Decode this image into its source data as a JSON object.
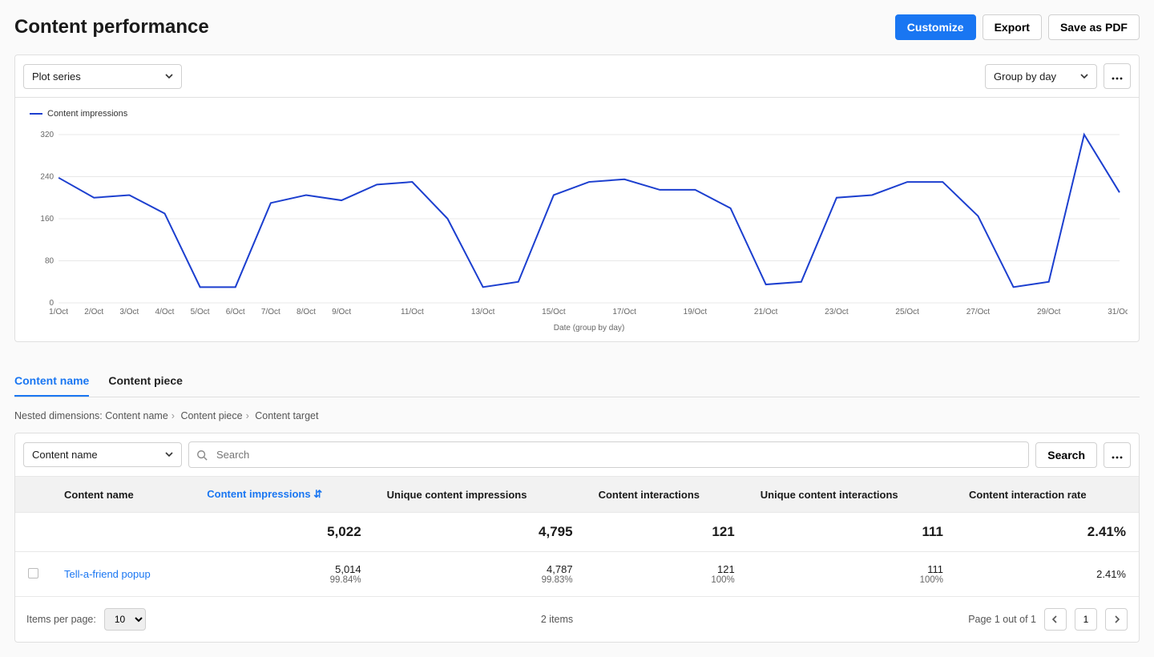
{
  "header": {
    "title": "Content performance",
    "customize": "Customize",
    "export": "Export",
    "savePdf": "Save as PDF"
  },
  "chartToolbar": {
    "plotSeries": "Plot series",
    "groupBy": "Group by day"
  },
  "chart_data": {
    "type": "line",
    "title": "",
    "xlabel": "Date (group by day)",
    "ylabel": "",
    "ylim": [
      0,
      320
    ],
    "legend": "Content impressions",
    "categories": [
      "1/Oct",
      "2/Oct",
      "3/Oct",
      "4/Oct",
      "5/Oct",
      "6/Oct",
      "7/Oct",
      "8/Oct",
      "9/Oct",
      "10/Oct",
      "11/Oct",
      "12/Oct",
      "13/Oct",
      "14/Oct",
      "15/Oct",
      "16/Oct",
      "17/Oct",
      "18/Oct",
      "19/Oct",
      "20/Oct",
      "21/Oct",
      "22/Oct",
      "23/Oct",
      "24/Oct",
      "25/Oct",
      "26/Oct",
      "27/Oct",
      "28/Oct",
      "29/Oct",
      "30/Oct",
      "31/Oct"
    ],
    "xTicks": [
      "1/Oct",
      "2/Oct",
      "3/Oct",
      "4/Oct",
      "5/Oct",
      "6/Oct",
      "7/Oct",
      "8/Oct",
      "9/Oct",
      "11/Oct",
      "13/Oct",
      "15/Oct",
      "17/Oct",
      "19/Oct",
      "21/Oct",
      "23/Oct",
      "25/Oct",
      "27/Oct",
      "29/Oct",
      "31/Oct"
    ],
    "yTicks": [
      0,
      80,
      160,
      240,
      320
    ],
    "series": [
      {
        "name": "Content impressions",
        "values": [
          238,
          200,
          205,
          170,
          30,
          30,
          190,
          205,
          195,
          225,
          230,
          160,
          30,
          40,
          205,
          230,
          235,
          215,
          215,
          180,
          35,
          40,
          200,
          205,
          230,
          230,
          165,
          30,
          40,
          320,
          210
        ]
      }
    ]
  },
  "tabs": {
    "contentName": "Content name",
    "contentPiece": "Content piece"
  },
  "bc": {
    "label": "Nested dimensions:",
    "a": "Content name",
    "b": "Content piece",
    "c": "Content target"
  },
  "tableToolbar": {
    "dimension": "Content name",
    "searchPlaceholder": "Search",
    "searchBtn": "Search"
  },
  "columns": {
    "c1": "Content name",
    "c2": "Content impressions",
    "c3": "Unique content impressions",
    "c4": "Content interactions",
    "c5": "Unique content interactions",
    "c6": "Content interaction rate"
  },
  "totals": {
    "c2": "5,022",
    "c3": "4,795",
    "c4": "121",
    "c5": "111",
    "c6": "2.41%"
  },
  "rows": [
    {
      "name": "Tell-a-friend popup",
      "c2": "5,014",
      "c2s": "99.84%",
      "c3": "4,787",
      "c3s": "99.83%",
      "c4": "121",
      "c4s": "100%",
      "c5": "111",
      "c5s": "100%",
      "c6": "2.41%"
    }
  ],
  "pager": {
    "itemsLabel": "Items per page:",
    "perPage": "10",
    "count": "2 items",
    "pageInfo": "Page 1 out of 1",
    "page": "1"
  }
}
